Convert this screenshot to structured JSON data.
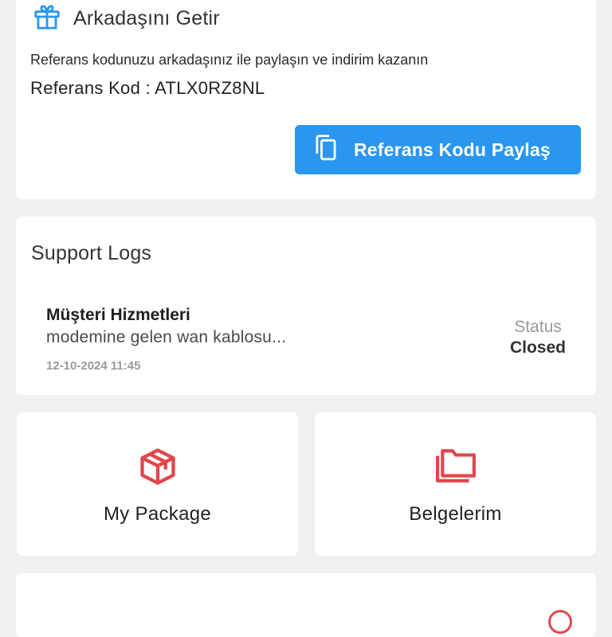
{
  "referral": {
    "title": "Arkadaşını Getir",
    "description": "Referans kodunuzu arkadaşınız ile paylaşın ve indirim kazanın",
    "code_line": "Referans Kod : ATLX0RZ8NL",
    "share_button": "Referans Kodu Paylaş",
    "icon": "gift-icon"
  },
  "support": {
    "title": "Support Logs",
    "logs": [
      {
        "title": "Müşteri Hizmetleri",
        "message": "modemine gelen wan kablosu...",
        "date": "12-10-2024 11:45",
        "status_label": "Status",
        "status_value": "Closed"
      }
    ]
  },
  "tiles": [
    {
      "label": "My Package",
      "icon": "package-box-icon"
    },
    {
      "label": "Belgelerim",
      "icon": "folder-icon"
    }
  ],
  "colors": {
    "background": "#f1f1f3",
    "primary_blue": "#2b96ef",
    "accent_red": "#e0474c",
    "card": "#ffffff"
  }
}
